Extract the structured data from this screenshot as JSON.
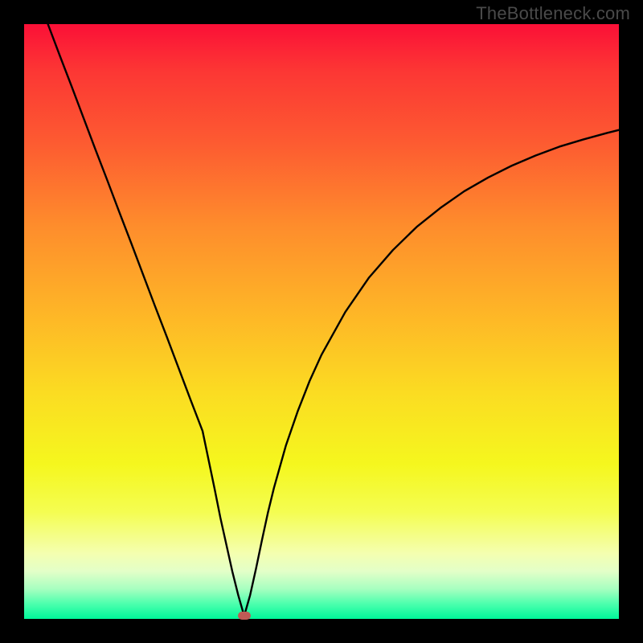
{
  "watermark": "TheBottleneck.com",
  "chart_data": {
    "type": "line",
    "title": "",
    "xlabel": "",
    "ylabel": "",
    "xlim": [
      0,
      100
    ],
    "ylim": [
      0,
      100
    ],
    "grid": false,
    "legend": false,
    "annotations": [
      {
        "type": "marker",
        "x": 37,
        "y": 0.5,
        "color": "#c05a55",
        "shape": "pill"
      }
    ],
    "series": [
      {
        "name": "bottleneck-curve",
        "color": "#000000",
        "x": [
          4,
          6,
          8,
          10,
          12,
          14,
          16,
          18,
          20,
          22,
          24,
          26,
          28,
          30,
          32,
          33,
          34,
          35,
          36,
          37,
          38,
          39,
          40,
          41,
          42,
          44,
          46,
          48,
          50,
          54,
          58,
          62,
          66,
          70,
          74,
          78,
          82,
          86,
          90,
          94,
          98,
          100
        ],
        "values": [
          100,
          94.7,
          89.5,
          84.2,
          78.9,
          73.7,
          68.4,
          63.2,
          57.9,
          52.6,
          47.4,
          42.1,
          36.8,
          31.6,
          22.0,
          17.0,
          12.5,
          8.0,
          4.0,
          0.5,
          4.0,
          8.5,
          13.3,
          17.9,
          22.0,
          29.1,
          34.9,
          40.0,
          44.4,
          51.6,
          57.4,
          62.0,
          65.9,
          69.1,
          71.9,
          74.2,
          76.2,
          77.9,
          79.4,
          80.6,
          81.7,
          82.2
        ]
      }
    ]
  },
  "colors": {
    "background": "#000000",
    "gradient_top": "#fb1037",
    "gradient_bottom": "#00f79a",
    "curve": "#000000",
    "marker": "#c05a55",
    "watermark": "#4a4a4a"
  }
}
